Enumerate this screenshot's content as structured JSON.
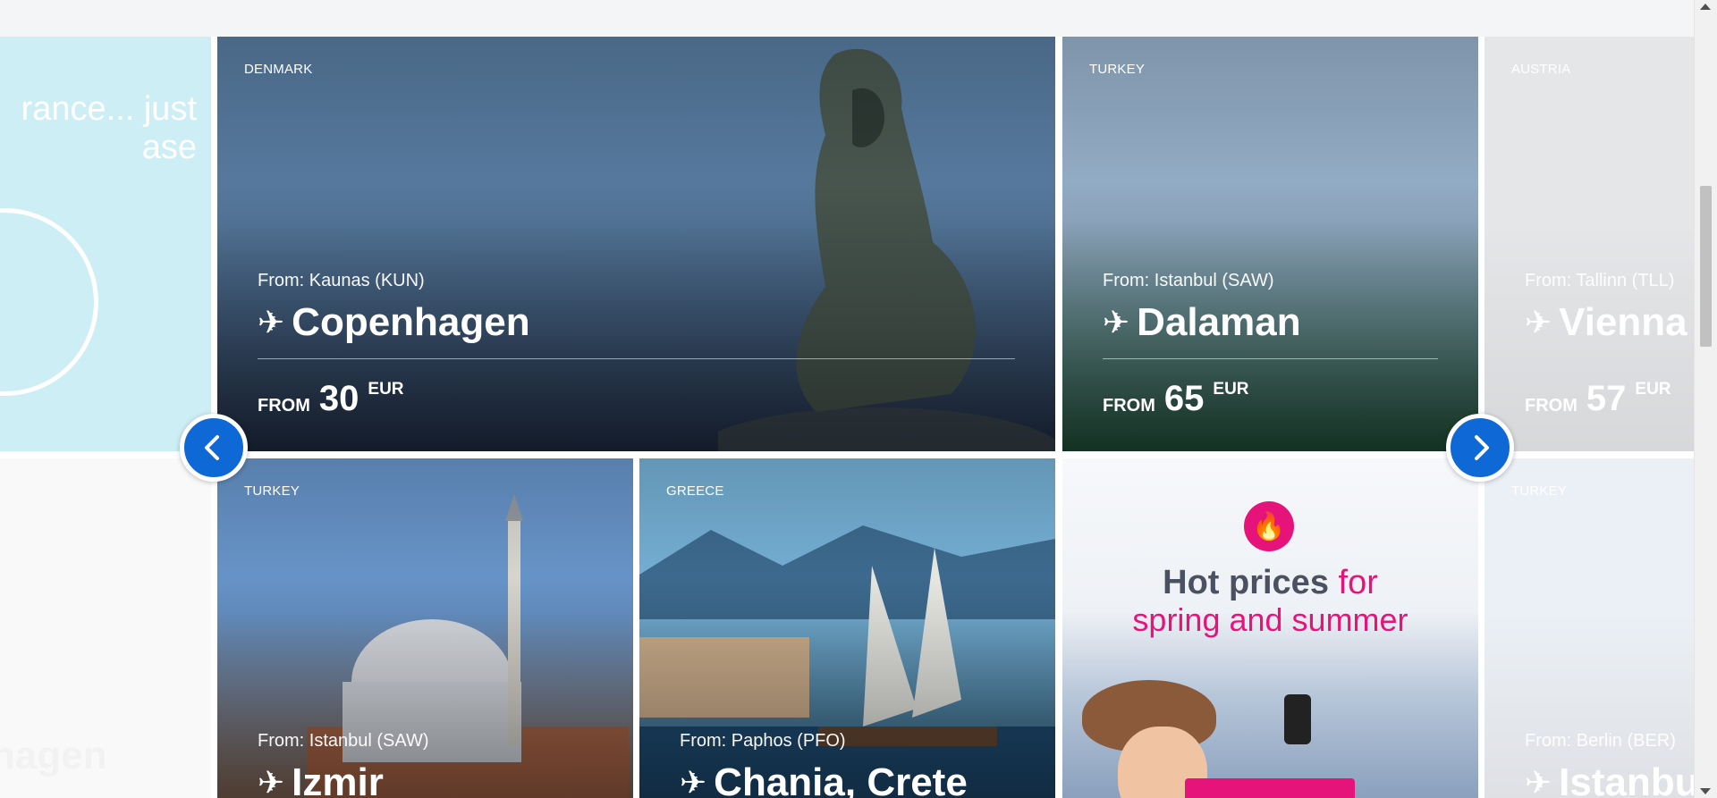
{
  "insurance_card": {
    "text": "rance... just\nase"
  },
  "left_bottom_card": {
    "dest": "hagen"
  },
  "cards": [
    {
      "id": "copenhagen",
      "country": "DENMARK",
      "from": "From: Kaunas (KUN)",
      "dest": "Copenhagen",
      "price_label": "FROM",
      "price": "30",
      "currency": "EUR",
      "bg": "#5a7fa5",
      "bg2": "#23324b"
    },
    {
      "id": "dalaman",
      "country": "TURKEY",
      "from": "From: Istanbul (SAW)",
      "dest": "Dalaman",
      "price_label": "FROM",
      "price": "65",
      "currency": "EUR",
      "bg": "#9ab5cf",
      "bg2": "#245a3f"
    },
    {
      "id": "vienna",
      "country": "AUSTRIA",
      "from": "From: Tallinn (TLL)",
      "dest": "Vienna",
      "price_label": "FROM",
      "price": "57",
      "currency": "EUR",
      "bg": "#b6b9bf",
      "bg2": "#8e9198"
    },
    {
      "id": "izmir",
      "country": "TURKEY",
      "from": "From: Istanbul (SAW)",
      "dest": "Izmir",
      "bg": "#6c9bd2",
      "bg2": "#8e6e5a"
    },
    {
      "id": "chania",
      "country": "GREECE",
      "from": "From: Paphos (PFO)",
      "dest": "Chania, Crete",
      "bg": "#7ab7de",
      "bg2": "#2f5e7c"
    },
    {
      "id": "istanbul",
      "country": "TURKEY",
      "from": "From: Berlin (BER)",
      "dest": "Istanbu",
      "bg": "#c8d6e6",
      "bg2": "#a3a9b4"
    }
  ],
  "promo": {
    "title_main": "Hot prices",
    "title_for": "for",
    "subtitle": "spring and summer"
  },
  "nav": {
    "prev_icon": "chevron-left-icon",
    "next_icon": "chevron-right-icon",
    "color": "#0e68d6"
  },
  "colors": {
    "accent_pink": "#e6147a"
  }
}
